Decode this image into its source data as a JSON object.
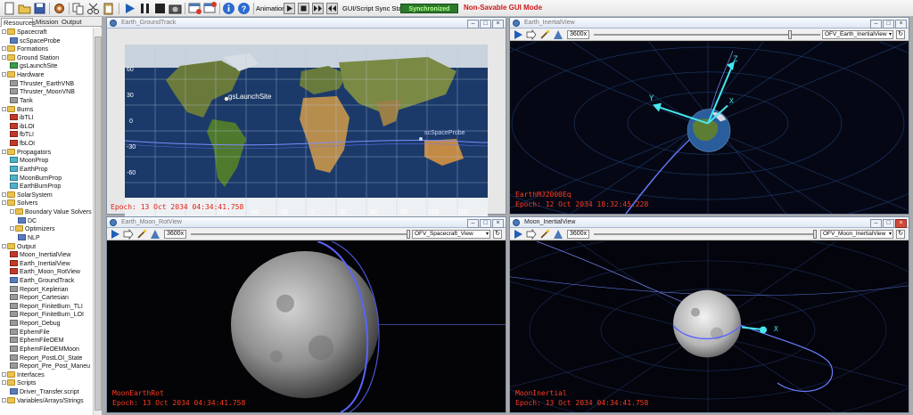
{
  "toolbar": {
    "animation_label": "Animation",
    "sync_label": "GUI/Script Sync Status:",
    "sync_status": "Synchronized",
    "mode_warning": "Non-Savable GUI Mode",
    "colors": {
      "sync_bg": "#2b7a2b",
      "warning": "#d01818"
    }
  },
  "tabs": [
    "Resources",
    "Mission",
    "Output"
  ],
  "tree": [
    {
      "label": "Spacecraft",
      "level": 0,
      "icon": "folder"
    },
    {
      "label": "scSpaceProbe",
      "level": 1,
      "icon": "spacecraft"
    },
    {
      "label": "Formations",
      "level": 0,
      "icon": "folder"
    },
    {
      "label": "Ground Station",
      "level": 0,
      "icon": "folder"
    },
    {
      "label": "gsLaunchSite",
      "level": 1,
      "icon": "groundstation"
    },
    {
      "label": "Hardware",
      "level": 0,
      "icon": "folder"
    },
    {
      "label": "Thruster_EarthVNB",
      "level": 1,
      "icon": "thruster"
    },
    {
      "label": "Thruster_MoonVNB",
      "level": 1,
      "icon": "thruster"
    },
    {
      "label": "Tank",
      "level": 1,
      "icon": "tank"
    },
    {
      "label": "Burns",
      "level": 0,
      "icon": "folder"
    },
    {
      "label": "ibTLI",
      "level": 1,
      "icon": "burn"
    },
    {
      "label": "ibLOI",
      "level": 1,
      "icon": "burn"
    },
    {
      "label": "fbTLI",
      "level": 1,
      "icon": "burn"
    },
    {
      "label": "fbLOI",
      "level": 1,
      "icon": "burn"
    },
    {
      "label": "Propagators",
      "level": 0,
      "icon": "folder"
    },
    {
      "label": "MoonProp",
      "level": 1,
      "icon": "propagator"
    },
    {
      "label": "EarthProp",
      "level": 1,
      "icon": "propagator"
    },
    {
      "label": "MoonBurnProp",
      "level": 1,
      "icon": "propagator"
    },
    {
      "label": "EarthBurnProp",
      "level": 1,
      "icon": "propagator"
    },
    {
      "label": "SolarSystem",
      "level": 0,
      "icon": "folder"
    },
    {
      "label": "Solvers",
      "level": 0,
      "icon": "folder"
    },
    {
      "label": "Boundary Value Solvers",
      "level": 1,
      "icon": "folder"
    },
    {
      "label": "DC",
      "level": 2,
      "icon": "solver"
    },
    {
      "label": "Optimizers",
      "level": 1,
      "icon": "folder"
    },
    {
      "label": "NLP",
      "level": 2,
      "icon": "solver"
    },
    {
      "label": "Output",
      "level": 0,
      "icon": "folder"
    },
    {
      "label": "Moon_InertialView",
      "level": 1,
      "icon": "view"
    },
    {
      "label": "Earth_InertialView",
      "level": 1,
      "icon": "view"
    },
    {
      "label": "Earth_Moon_RotView",
      "level": 1,
      "icon": "view"
    },
    {
      "label": "Earth_GroundTrack",
      "level": 1,
      "icon": "groundtrack"
    },
    {
      "label": "Report_Keplerian",
      "level": 1,
      "icon": "report"
    },
    {
      "label": "Report_Cartesian",
      "level": 1,
      "icon": "report"
    },
    {
      "label": "Report_FiniteBurn_TLI",
      "level": 1,
      "icon": "report"
    },
    {
      "label": "Report_FiniteBurn_LOI",
      "level": 1,
      "icon": "report"
    },
    {
      "label": "Report_Debug",
      "level": 1,
      "icon": "report"
    },
    {
      "label": "EphemFile",
      "level": 1,
      "icon": "report"
    },
    {
      "label": "EphemFileOEM",
      "level": 1,
      "icon": "report"
    },
    {
      "label": "EphemFileOEMMoon",
      "level": 1,
      "icon": "report"
    },
    {
      "label": "Report_PostLOI_State",
      "level": 1,
      "icon": "report"
    },
    {
      "label": "Report_Pre_Post_Maneu",
      "level": 1,
      "icon": "report"
    },
    {
      "label": "Interfaces",
      "level": 0,
      "icon": "folder"
    },
    {
      "label": "Scripts",
      "level": 0,
      "icon": "folder"
    },
    {
      "label": "Driver_Transfer.script",
      "level": 1,
      "icon": "script"
    },
    {
      "label": "Variables/Arrays/Strings",
      "level": 0,
      "icon": "folder"
    }
  ],
  "views": {
    "ground_track": {
      "title": "Earth_GroundTrack",
      "epoch": "Epoch: 13 Oct 2034 04:34:41.758",
      "lat_ticks": [
        "60",
        "30",
        "0",
        "-30",
        "-60"
      ],
      "lon_ticks": [
        "-90",
        "-60",
        "-30",
        "0",
        "30",
        "60",
        "90",
        "120",
        "150"
      ],
      "labels": {
        "station": "gsLaunchSite",
        "spacecraft": "scSpaceProbe"
      }
    },
    "earth_inertial": {
      "title": "Earth_InertialView",
      "speed": "3600x",
      "view_option": "OFV_Earth_InertialView",
      "frame_label": "EarthMJ2000Eq",
      "epoch": "Epoch: 12 Oct 2034 18:32:45.228",
      "axes": [
        "Z",
        "Y",
        "X"
      ]
    },
    "rot_view": {
      "title": "Earth_Moon_RotView",
      "speed": "3600x",
      "view_option": "OFV_Spacecraft_View",
      "frame_label": "MoonEarthRot",
      "epoch": "Epoch: 13 Oct 2034 04:34:41.758"
    },
    "moon_inertial": {
      "title": "Moon_InertialView",
      "speed": "3600x",
      "view_option": "OFV_Moon_InertialView",
      "frame_label": "MoonInertial",
      "epoch": "Epoch: 13 Oct 2034 04:34:41.758",
      "axes": [
        "X"
      ]
    }
  }
}
